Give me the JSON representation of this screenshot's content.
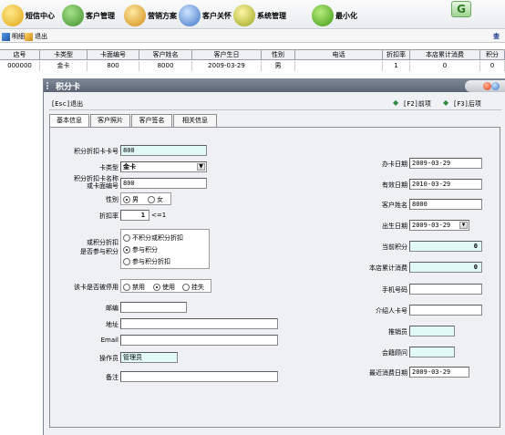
{
  "toolbar": {
    "items": [
      {
        "label": "短信中心"
      },
      {
        "label": "客户管理"
      },
      {
        "label": "营销方案"
      },
      {
        "label": "客户关怀"
      },
      {
        "label": "系统管理"
      },
      {
        "label": "最小化"
      }
    ],
    "logo_text": "G"
  },
  "subbar": {
    "detail_label": "明细",
    "exit_label": "退出",
    "right_label": "查"
  },
  "grid": {
    "headers": [
      "店号",
      "卡类型",
      "卡面编号",
      "客户姓名",
      "客户生日",
      "性别",
      "电话",
      "折扣率",
      "本店累计消费",
      "积分"
    ],
    "row": [
      "000000",
      "金卡",
      "800",
      "8000",
      "2009-03-29",
      "男",
      "",
      "1",
      "0",
      "0"
    ]
  },
  "window": {
    "title": "积分卡",
    "esc_label": "[Esc]退出",
    "prev_label": "[F2]前项",
    "next_label": "[F3]后项"
  },
  "tabs": [
    {
      "label": "基本信息",
      "active": true
    },
    {
      "label": "客户照片",
      "active": false
    },
    {
      "label": "客户签名",
      "active": false
    },
    {
      "label": "相关信息",
      "active": false
    }
  ],
  "form": {
    "card_no_label": "积分折扣卡卡号",
    "card_no_value": "800",
    "card_type_label": "卡类型",
    "card_type_value": "金卡",
    "card_face_label_1": "积分折扣卡名称",
    "card_face_label_2": "或卡面编号",
    "card_face_value": "800",
    "gender_label": "性别",
    "gender_options": [
      "男",
      "女"
    ],
    "gender_selected": "男",
    "discount_label": "折扣率",
    "discount_value": "1",
    "discount_hint": "<=1",
    "points_label_1": "或积分折扣",
    "points_label_2": "是否参与积分",
    "points_options": [
      "不积分或积分折扣",
      "参与积分",
      "参与积分折扣"
    ],
    "points_selected": "参与积分",
    "status_label": "该卡是否被停用",
    "status_options": [
      "禁用",
      "使用",
      "挂失"
    ],
    "status_selected": "使用",
    "zip_label": "邮编",
    "zip_value": "",
    "address_label": "地址",
    "address_value": "",
    "email_label": "Email",
    "email_value": "",
    "operator_label": "操作员",
    "operator_value": "管理员",
    "remark_label": "备注",
    "remark_value": "",
    "issue_date_label": "办卡日期",
    "issue_date_value": "2009-03-29",
    "valid_date_label": "有效日期",
    "valid_date_value": "2010-03-29",
    "customer_name_label": "客户姓名",
    "customer_name_value": "8000",
    "birthday_label": "出生日期",
    "birthday_value": "2009-03-29",
    "current_points_label": "当前积分",
    "current_points_value": "0",
    "total_spend_label": "本店累计消费",
    "total_spend_value": "0",
    "phone_label": "手机号码",
    "phone_value": "",
    "referrer_label": "介绍人卡号",
    "referrer_value": "",
    "salesman_label": "推销员",
    "salesman_value": "",
    "consultant_label": "会籍顾问",
    "consultant_value": "",
    "last_spend_label": "最近消费日期",
    "last_spend_value": "2009-03-29"
  },
  "colors": {
    "title_bar": "#5c6573",
    "cyan_field": "#e1faf8",
    "panel_bg": "#eef0f4"
  }
}
